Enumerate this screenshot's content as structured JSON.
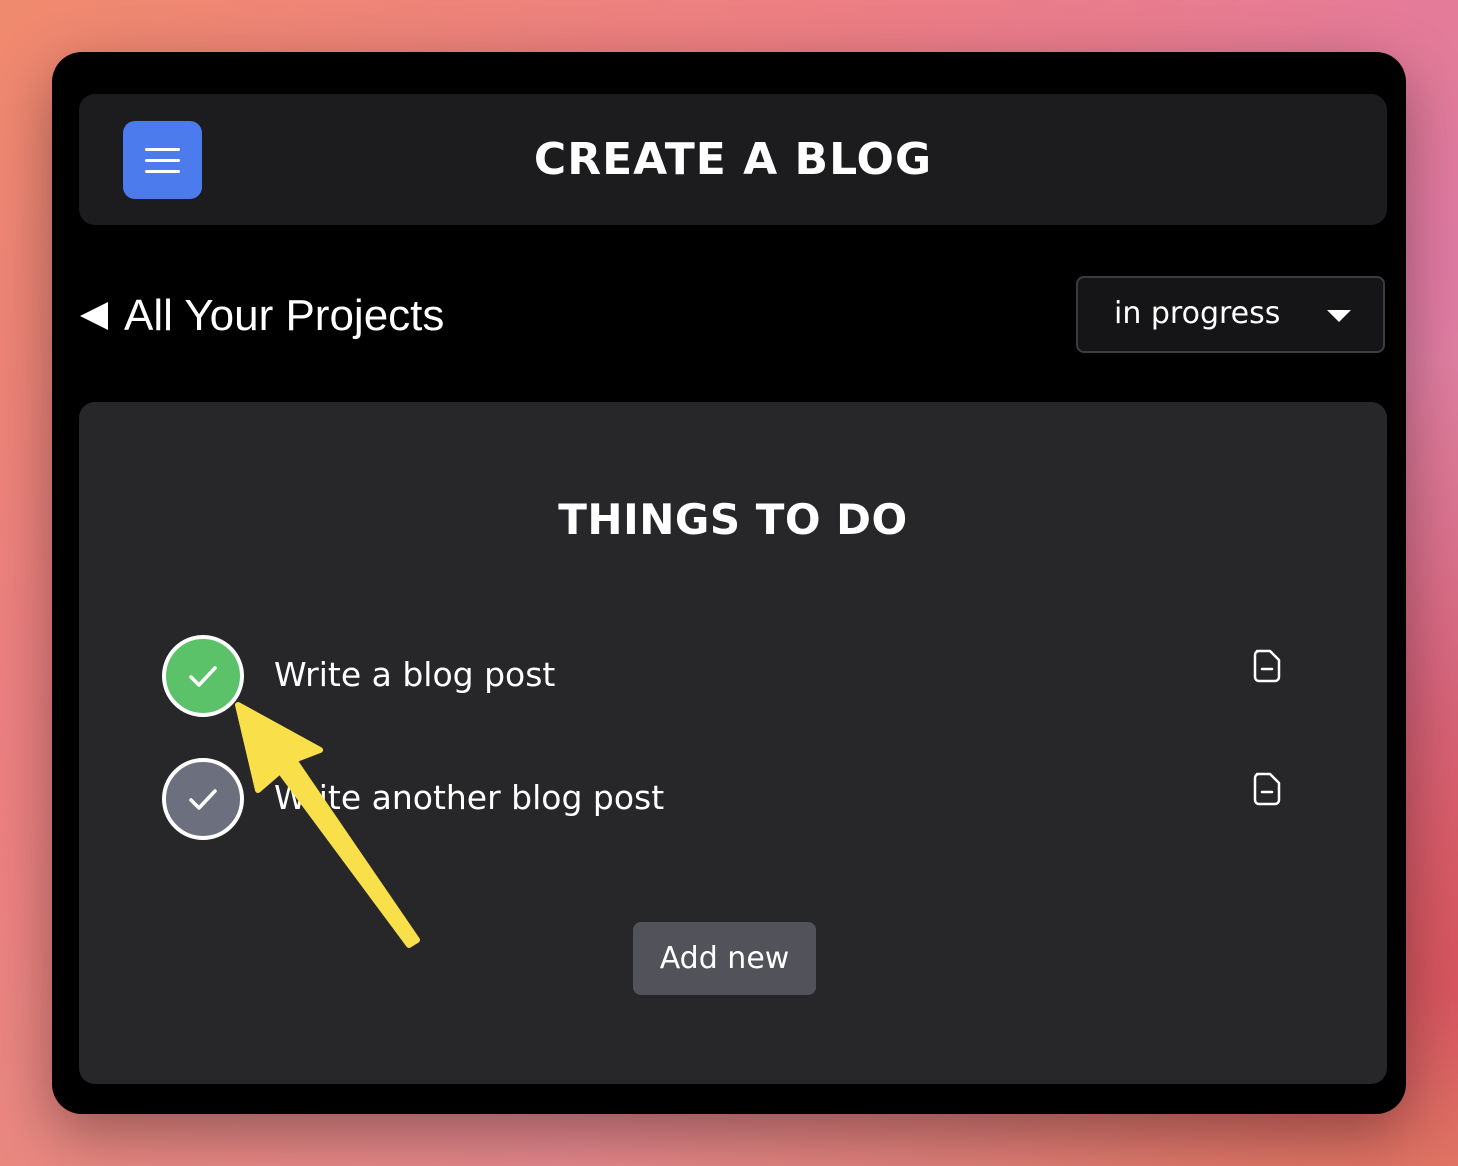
{
  "header": {
    "title": "CREATE A BLOG",
    "menu_icon": "hamburger-menu-icon"
  },
  "nav": {
    "back_label": "All Your Projects",
    "back_icon": "triangle-left-icon"
  },
  "status_filter": {
    "selected": "in progress",
    "icon": "caret-down-icon"
  },
  "todo": {
    "title": "THINGS TO DO",
    "items": [
      {
        "label": "Write a blog post",
        "completed": true,
        "icon": "document-icon"
      },
      {
        "label": "Write another blog post",
        "completed": false,
        "icon": "document-icon"
      }
    ],
    "add_label": "Add new"
  },
  "colors": {
    "accent": "#4b7bec",
    "completed": "#5cc26a",
    "pending": "#6b6f7e",
    "annotation_arrow": "#f9e04b"
  }
}
